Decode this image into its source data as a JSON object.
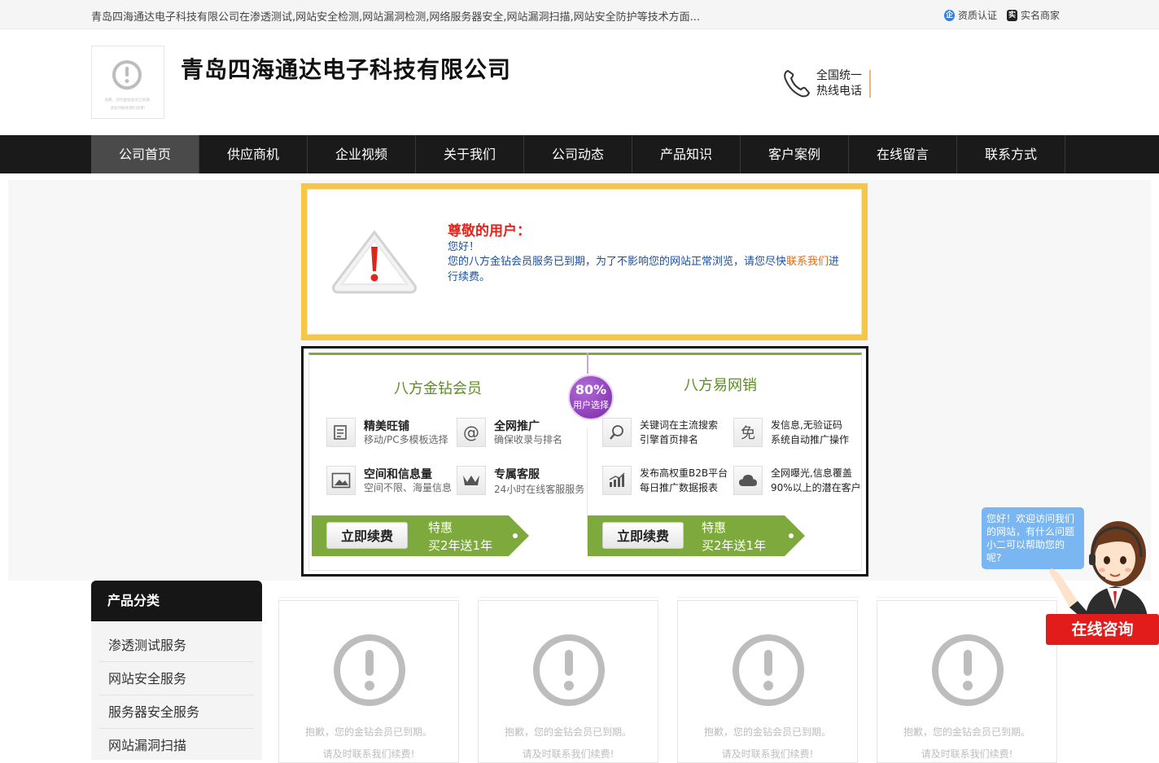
{
  "topbar": {
    "description": "青岛四海通达电子科技有限公司在渗透测试,网站安全检测,网站漏洞检测,网络服务器安全,网站漏洞扫描,网站安全防护等技术方面...",
    "badges": [
      {
        "label": "资质认证",
        "icon": "企"
      },
      {
        "label": "实名商家",
        "icon": "实"
      }
    ]
  },
  "header": {
    "company_name": "青岛四海通达电子科技有限公司",
    "logo_placeholder_line1": "抱歉，您的金钻会员已到期,",
    "logo_placeholder_line2": "请及时联系我们续费!",
    "hotline_line1": "全国统一",
    "hotline_line2": "热线电话"
  },
  "nav": {
    "items": [
      "公司首页",
      "供应商机",
      "企业视频",
      "关于我们",
      "公司动态",
      "产品知识",
      "客户案例",
      "在线留言",
      "联系方式"
    ],
    "active_index": 0
  },
  "notice": {
    "title": "尊敬的用户：",
    "greeting": "您好！",
    "message_part1": "您的八方金钻会员服务已到期，为了不影响您的网站正常浏览，请您尽快",
    "message_link": "联系我们",
    "message_part2": "进行续费。"
  },
  "promo": {
    "left_title": "八方金钻会员",
    "right_title": "八方易网销",
    "badge_percent": "80%",
    "badge_sub": "用户选择",
    "left_features": [
      {
        "title": "精美旺铺",
        "subtitle": "移动/PC多模板选择",
        "icon": "shop-icon"
      },
      {
        "title": "全网推广",
        "subtitle": "确保收录与排名",
        "icon": "at-icon"
      },
      {
        "title": "空间和信息量",
        "subtitle": "空间不限、海量信息",
        "icon": "image-icon"
      },
      {
        "title": "专属客服",
        "subtitle": "24小时在线客服服务",
        "icon": "crown-icon"
      }
    ],
    "right_features": [
      {
        "line1": "关键词在主流搜索",
        "line2": "引擎首页排名",
        "icon": "magnifier-icon"
      },
      {
        "line1": "发信息,无验证码",
        "line2": "系统自动推广操作",
        "icon": "free-icon"
      },
      {
        "line1": "发布高权重B2B平台",
        "line2": "每日推广数据报表",
        "icon": "chart-icon"
      },
      {
        "line1": "全网曝光,信息覆盖",
        "line2": "90%以上的潜在客户",
        "icon": "cloud-icon"
      }
    ],
    "renew_button": "立即续费",
    "special_line1": "特惠",
    "special_line2": "买2年送1年"
  },
  "sidebar": {
    "title": "产品分类",
    "items": [
      "渗透测试服务",
      "网站安全服务",
      "服务器安全服务",
      "网站漏洞扫描"
    ]
  },
  "cards": {
    "message_line1": "抱歉，您的金钻会员已到期。",
    "message_line2": "请及时联系我们续费!",
    "count": 4
  },
  "chat": {
    "bubble_text": "您好！欢迎访问我们的网站，有什么问题小二可以帮助您的呢?",
    "button_label": "在线咨询"
  },
  "colors": {
    "nav_bg": "#1a1a1a",
    "nav_active": "#4a4a4a",
    "notice_border": "#f6c648",
    "notice_title": "#e0261c",
    "notice_text": "#1a4fa0",
    "promo_green": "#7ea93c",
    "chat_red": "#e21b1b",
    "bubble_blue": "#79b6f2"
  }
}
